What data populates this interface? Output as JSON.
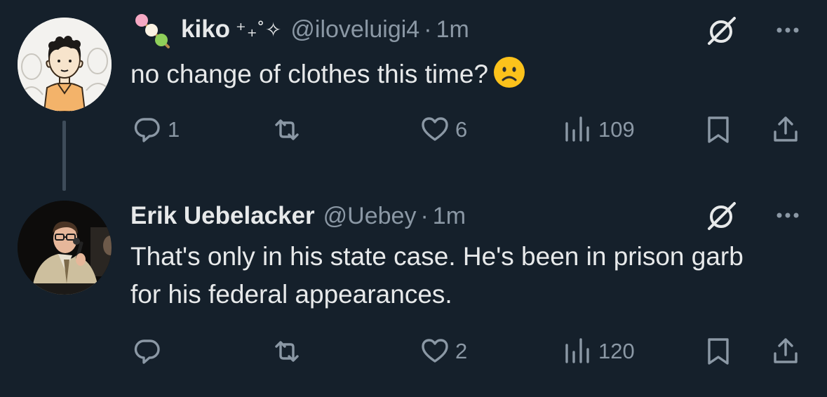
{
  "colors": {
    "background": "#15202b",
    "text_primary": "#e7e9ea",
    "text_secondary": "#8b98a5",
    "thread_line": "#3e4c5a"
  },
  "tweets": [
    {
      "avatar_icon": "cartoon-person-avatar",
      "name_emoji": "dango-emoji",
      "name": "kiko",
      "name_decoration": "⁺₊˚✧",
      "handle": "@iloveluigi4",
      "separator": "·",
      "time": "1m",
      "text": "no change of clothes this time?",
      "text_emoji": "frowning-face-emoji",
      "actions": {
        "reply_count": "1",
        "retweet_count": "",
        "like_count": "6",
        "view_count": "109"
      }
    },
    {
      "avatar_icon": "photo-avatar",
      "name": "Erik Uebelacker",
      "handle": "@Uebey",
      "separator": "·",
      "time": "1m",
      "text": "That's only in his state case. He's been in prison garb for his federal appearances.",
      "actions": {
        "reply_count": "",
        "retweet_count": "",
        "like_count": "2",
        "view_count": "120"
      }
    }
  ]
}
